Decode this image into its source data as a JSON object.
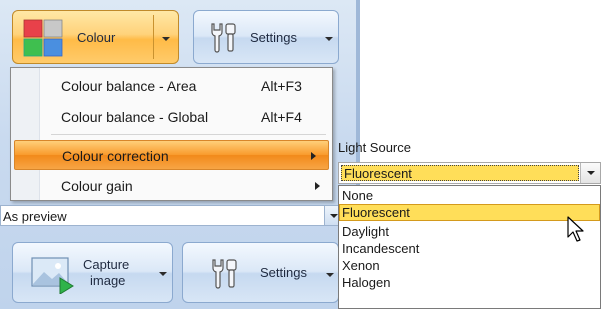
{
  "toolbar": {
    "colour_label": "Colour",
    "settings_label": "Settings"
  },
  "menu": {
    "items": [
      {
        "label": "Colour balance - Area",
        "shortcut": "Alt+F3"
      },
      {
        "label": "Colour balance - Global",
        "shortcut": "Alt+F4"
      },
      {
        "label": "Colour correction",
        "shortcut": ""
      },
      {
        "label": "Colour gain",
        "shortcut": ""
      }
    ]
  },
  "preview_select": {
    "value": "As preview"
  },
  "capture": {
    "label_line1": "Capture",
    "label_line2": "image",
    "settings_label": "Settings"
  },
  "light_source": {
    "title": "Light Source",
    "selected": "Fluorescent",
    "options": [
      "None",
      "Fluorescent",
      "Daylight",
      "Incandescent",
      "Xenon",
      "Halogen"
    ]
  },
  "colors": {
    "accent": "#f99a2c",
    "selection": "#ffde59",
    "ribbon": "#c9daef"
  },
  "icons": {
    "colour": "colour-grid-icon",
    "settings": "wrench-icon",
    "capture": "picture-play-icon",
    "cursor": "mouse-pointer-icon"
  }
}
